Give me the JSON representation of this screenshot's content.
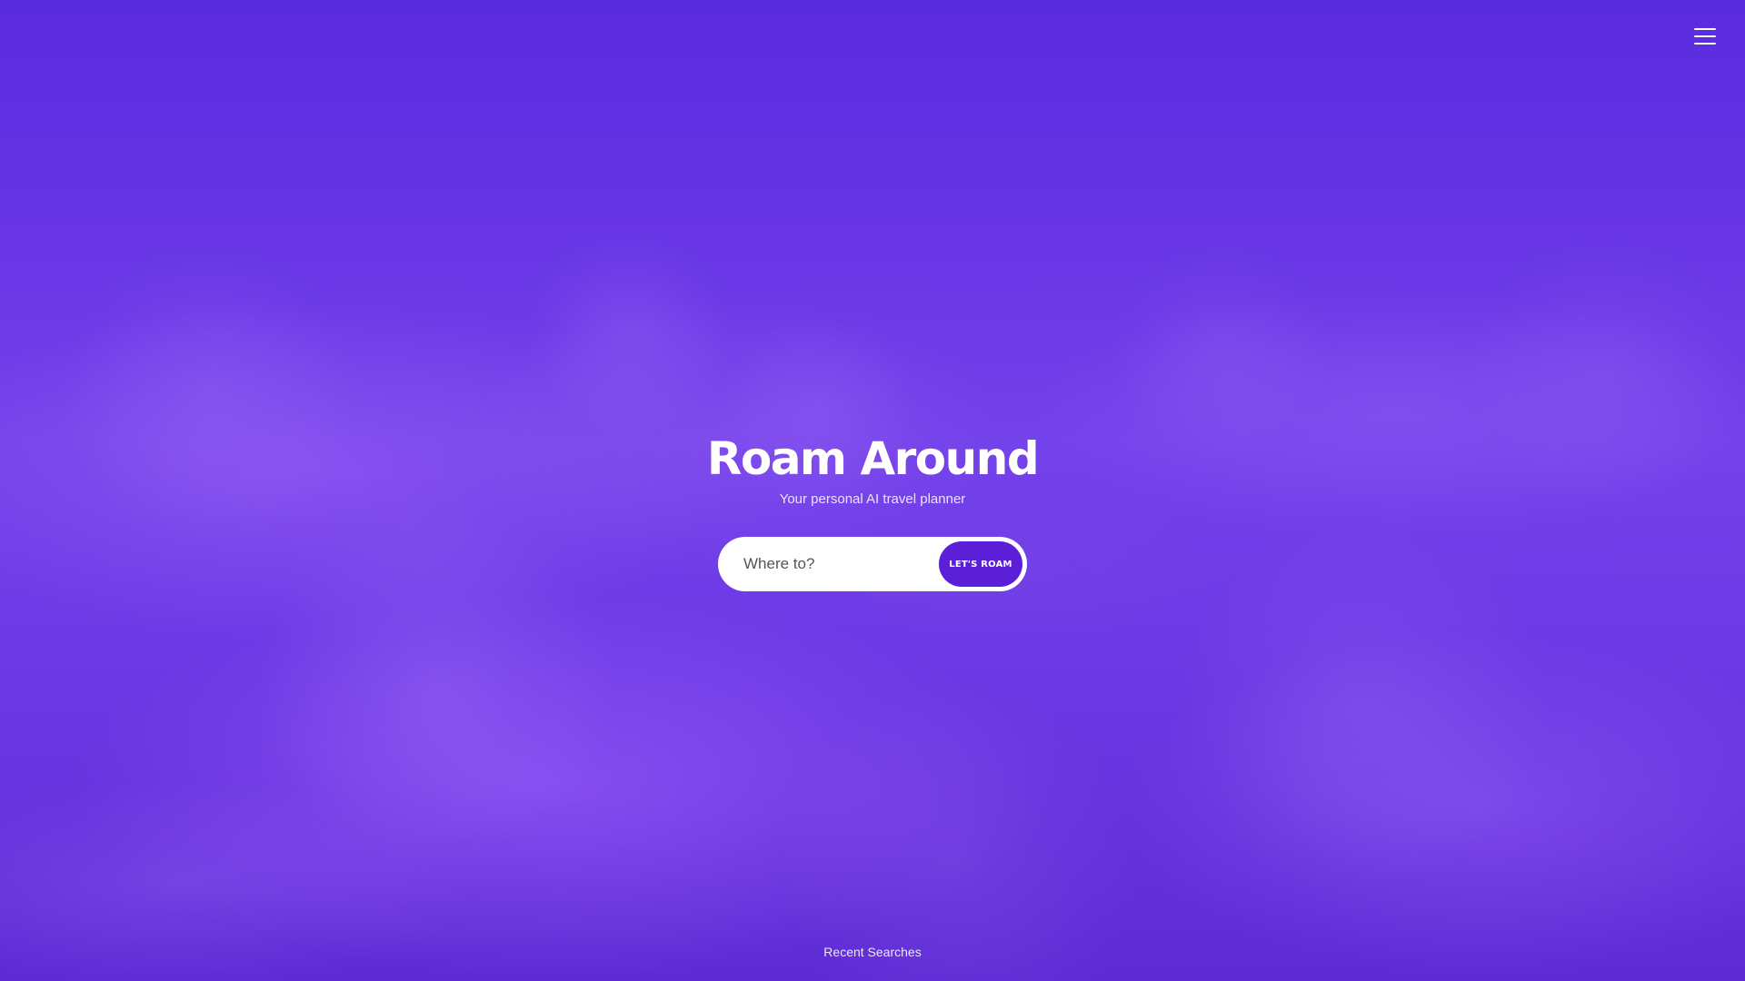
{
  "header": {
    "menu_icon": "hamburger-menu-icon"
  },
  "hero": {
    "title": "Roam Around",
    "subtitle": "Your personal AI travel planner"
  },
  "search": {
    "placeholder": "Where to?",
    "value": "",
    "button_label": "LET'S ROAM"
  },
  "footer": {
    "recent_searches_label": "Recent Searches"
  },
  "colors": {
    "background_top": "#5a2bdf",
    "background_mid": "#7442ea",
    "accent_button": "#5a1fd6",
    "text_primary": "#ffffff"
  }
}
